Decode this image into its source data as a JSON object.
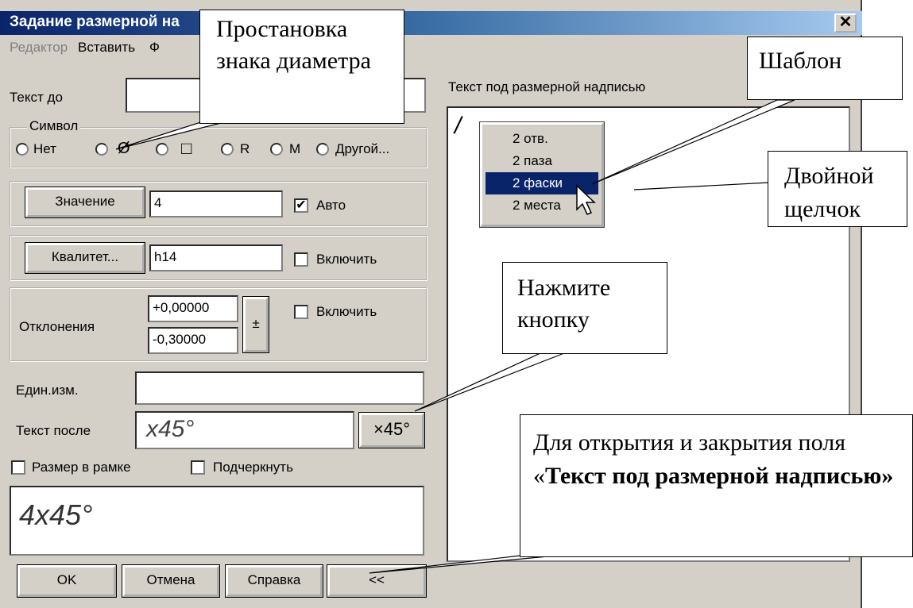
{
  "window": {
    "title": "Задание размерной на",
    "close_label": "✕"
  },
  "menu": {
    "items": [
      "Редактор",
      "Вставить",
      "Ф"
    ]
  },
  "text_before": {
    "label": "Текст до",
    "value": ""
  },
  "symbol": {
    "legend": "Символ",
    "options": [
      "Нет",
      "Ø",
      "□",
      "R",
      "M",
      "Другой..."
    ]
  },
  "value_row": {
    "button": "Значение",
    "value": "4",
    "checkbox_label": "Авто",
    "checked": true
  },
  "quality_row": {
    "button": "Квалитет...",
    "value": "h14",
    "checkbox_label": "Включить"
  },
  "deviations": {
    "label": "Отклонения",
    "upper": "+0,00000",
    "lower": "-0,30000",
    "pm_label": "±",
    "checkbox_label": "Включить"
  },
  "units": {
    "label": "Един.изм.",
    "value": ""
  },
  "text_after": {
    "label": "Текст после",
    "value": "x45°",
    "button": "×45°"
  },
  "options": {
    "frame_label": "Размер в рамке",
    "underline_label": "Подчеркнуть"
  },
  "preview": {
    "value": "4x45°"
  },
  "buttons": {
    "ok": "OK",
    "cancel": "Отмена",
    "help": "Справка",
    "toggle": "<<"
  },
  "right_panel": {
    "label": "Текст под размерной надписью",
    "cursor_text": "/"
  },
  "template_list": {
    "items": [
      "2 отв.",
      "2 паза",
      "2 фаски",
      "2 места"
    ],
    "selected": "2 фаски",
    "selected_color": "#0a246a"
  },
  "callouts": {
    "diameter": "Простановка знака диаметра",
    "template": "Шаблон",
    "double_click": "Двойной щелчок",
    "press_button": "Нажмите кнопку",
    "toggle_field_prefix": "Для открытия  и закрытия поля «",
    "toggle_field_bold": "Текст под размерной надписью»"
  }
}
